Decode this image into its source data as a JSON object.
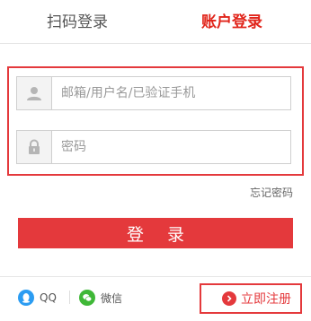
{
  "tabs": {
    "qr_login": "扫码登录",
    "account_login": "账户登录"
  },
  "form": {
    "username_placeholder": "邮箱/用户名/已验证手机",
    "username_value": "",
    "password_placeholder": "密码",
    "password_value": "",
    "forgot_password": "忘记密码",
    "login_button": "登录"
  },
  "footer": {
    "qq_label": "QQ",
    "wechat_label": "微信",
    "register_label": "立即注册"
  },
  "icons": {
    "user": "user-icon",
    "lock": "lock-icon",
    "qq": "qq-icon",
    "wechat": "wechat-icon",
    "register": "arrow-right-circle-icon"
  },
  "colors": {
    "accent": "#e4393c",
    "tab_active": "#e1251b",
    "qq": "#2b9cf2",
    "wechat": "#3fb837"
  }
}
